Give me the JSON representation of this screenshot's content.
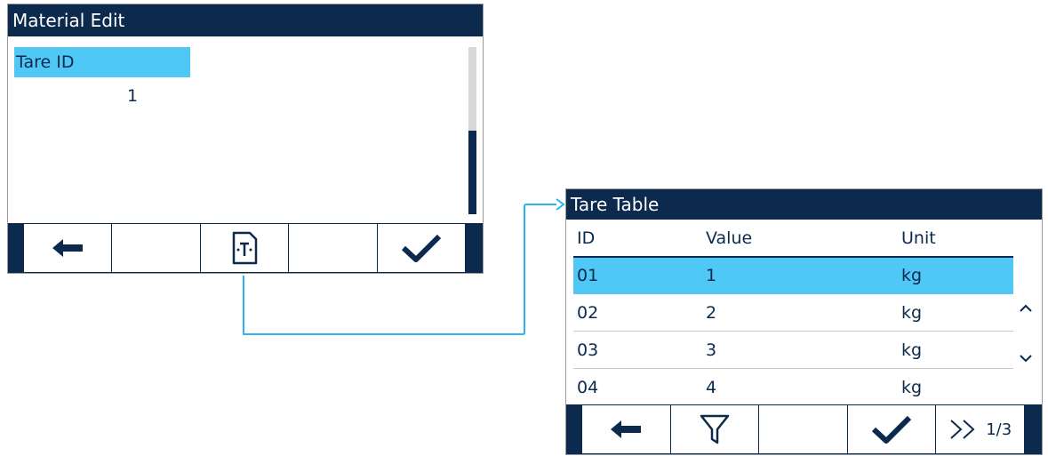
{
  "material_edit": {
    "title": "Material Edit",
    "field_label": "Tare ID",
    "field_value": "1",
    "softkeys": [
      {
        "icon": "back-arrow-icon",
        "label": ""
      },
      {
        "icon": "",
        "label": ""
      },
      {
        "icon": "tare-table-icon",
        "label": ""
      },
      {
        "icon": "",
        "label": ""
      },
      {
        "icon": "checkmark-icon",
        "label": ""
      }
    ]
  },
  "tare_table": {
    "title": "Tare Table",
    "columns": [
      "ID",
      "Value",
      "Unit"
    ],
    "rows": [
      {
        "id": "01",
        "value": "1",
        "unit": "kg",
        "selected": true
      },
      {
        "id": "02",
        "value": "2",
        "unit": "kg",
        "selected": false
      },
      {
        "id": "03",
        "value": "3",
        "unit": "kg",
        "selected": false
      },
      {
        "id": "04",
        "value": "4",
        "unit": "kg",
        "selected": false
      }
    ],
    "page_indicator": "1/3",
    "softkeys": [
      {
        "icon": "back-arrow-icon",
        "label": ""
      },
      {
        "icon": "filter-icon",
        "label": ""
      },
      {
        "icon": "",
        "label": ""
      },
      {
        "icon": "checkmark-icon",
        "label": ""
      },
      {
        "icon": "next-page-icon",
        "label": "1/3"
      }
    ]
  },
  "colors": {
    "navy": "#0b2a4e",
    "highlight": "#4fc8f5",
    "connector": "#29b6f0"
  }
}
